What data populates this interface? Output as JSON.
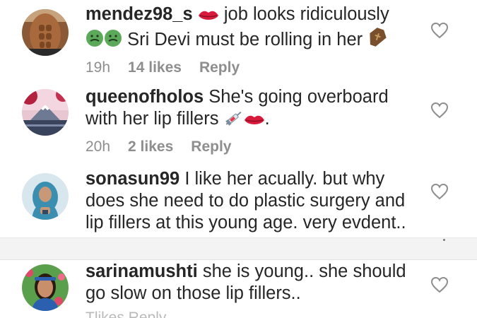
{
  "comments": [
    {
      "username": "mendez98_s",
      "text_1": "job looks ridiculously",
      "text_2": "Sri Devi must be rolling in her",
      "time": "19h",
      "likes": "14 likes",
      "reply": "Reply"
    },
    {
      "username": "queenofholos",
      "text_1": "She's going overboard",
      "text_2": "with her lip fillers",
      "text_3": ".",
      "time": "20h",
      "likes": "2 likes",
      "reply": "Reply"
    },
    {
      "username": "sonasun99",
      "text": "I like her acually. but why does she need to do plastic surgery and lip fillers at this young age. very evdent.."
    },
    {
      "username": "sarinamushti",
      "text": "she is young.. she should go slow on those lip fillers..",
      "meta_partial": "Tlikes  Reply"
    }
  ],
  "icons": {
    "lips": "lips-icon",
    "nauseated": "nauseated-face-icon",
    "coffin": "coffin-icon",
    "syringe": "syringe-icon",
    "heart": "heart-outline-icon"
  },
  "colors": {
    "text": "#262626",
    "meta": "#8e8e8e",
    "divider": "#f3f3f3"
  }
}
